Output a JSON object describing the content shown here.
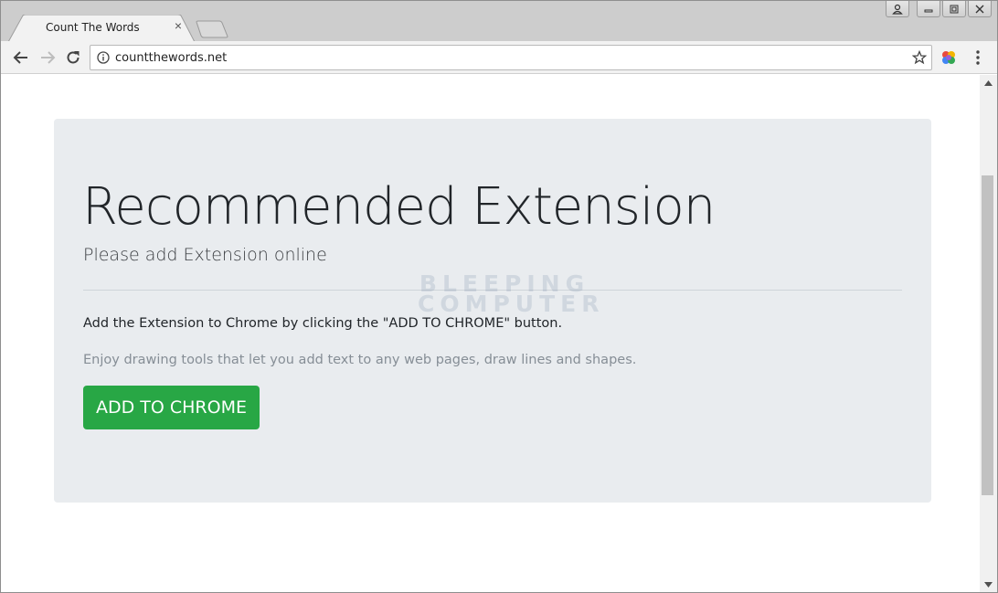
{
  "browser": {
    "tab_title": "Count The Words",
    "tab_close": "×",
    "url": "countthewords.net",
    "icons": {
      "back": "back-arrow-icon",
      "forward": "forward-arrow-icon",
      "reload": "reload-icon",
      "info": "info-icon",
      "bookmark": "star-icon",
      "extension": "extension-icon",
      "menu": "kebab-menu-icon"
    }
  },
  "page": {
    "headline": "Recommended Extension",
    "lead": "Please add Extension online",
    "paragraph1": "Add the Extension to Chrome by clicking the \"ADD TO CHROME\" button.",
    "paragraph2": "Enjoy drawing tools that let you add text to any web pages, draw lines and shapes.",
    "cta_label": "ADD TO CHROME",
    "watermark_line1": "BLEEPING",
    "watermark_line2": "COMPUTER"
  },
  "colors": {
    "jumbotron_bg": "#e9ecef",
    "cta_bg": "#28a745",
    "muted_text": "#868e96"
  }
}
